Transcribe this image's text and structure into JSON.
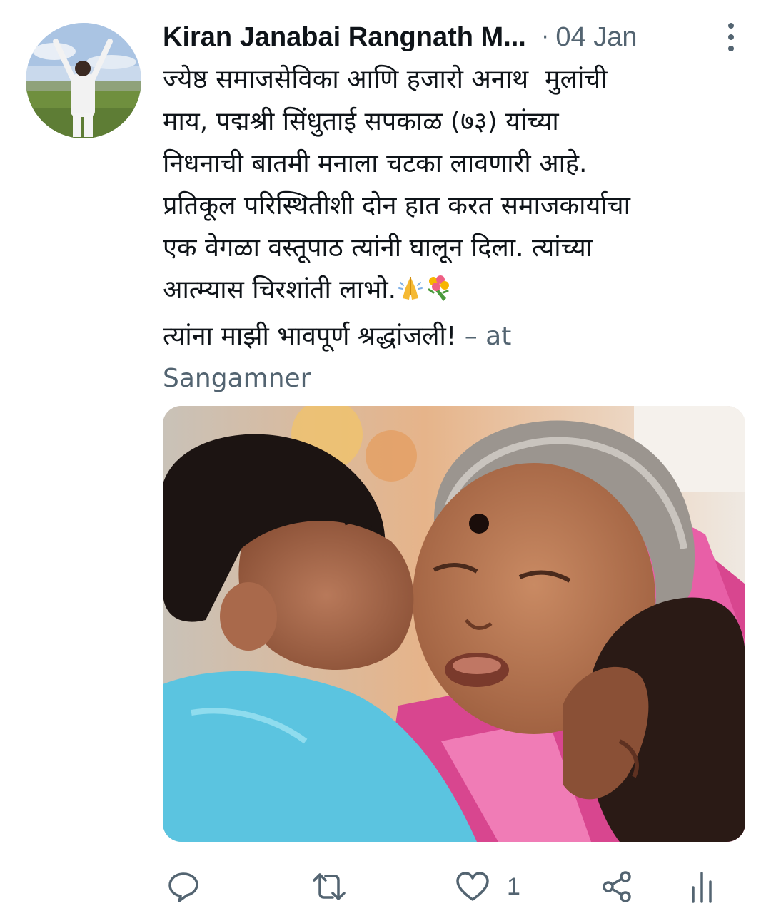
{
  "tweet": {
    "author_name": "Kiran Janabai Rangnath M...",
    "separator": "·",
    "date": "04 Jan",
    "lines": [
      "ज्येष्ठ समाजसेविका आणि हजारो अनाथ  मुलांची",
      "माय, पद्मश्री सिंधुताई सपकाळ (७३) यांच्या",
      "निधनाची बातमी मनाला चटका लावणारी आहे.",
      "प्रतिकूल परिस्थितीशी दोन हात करत समाजकार्याचा",
      "एक वेगळा वस्तूपाठ त्यांनी घालून दिला. त्यांच्या",
      "आत्म्यास चिरशांती लाभो."
    ],
    "emojis": [
      "folded-hands-emoji",
      "bouquet-emoji"
    ],
    "closing_line": "त्यांना माझी भावपूर्ण श्रद्धांजली!",
    "location_prefix": " – at",
    "location": "Sangamner"
  },
  "actions": {
    "like_count": "1",
    "icons": [
      "reply-icon",
      "retweet-icon",
      "like-icon",
      "share-icon",
      "analytics-icon"
    ]
  },
  "colors": {
    "primary_text": "#0f1419",
    "secondary_text": "#536471"
  }
}
